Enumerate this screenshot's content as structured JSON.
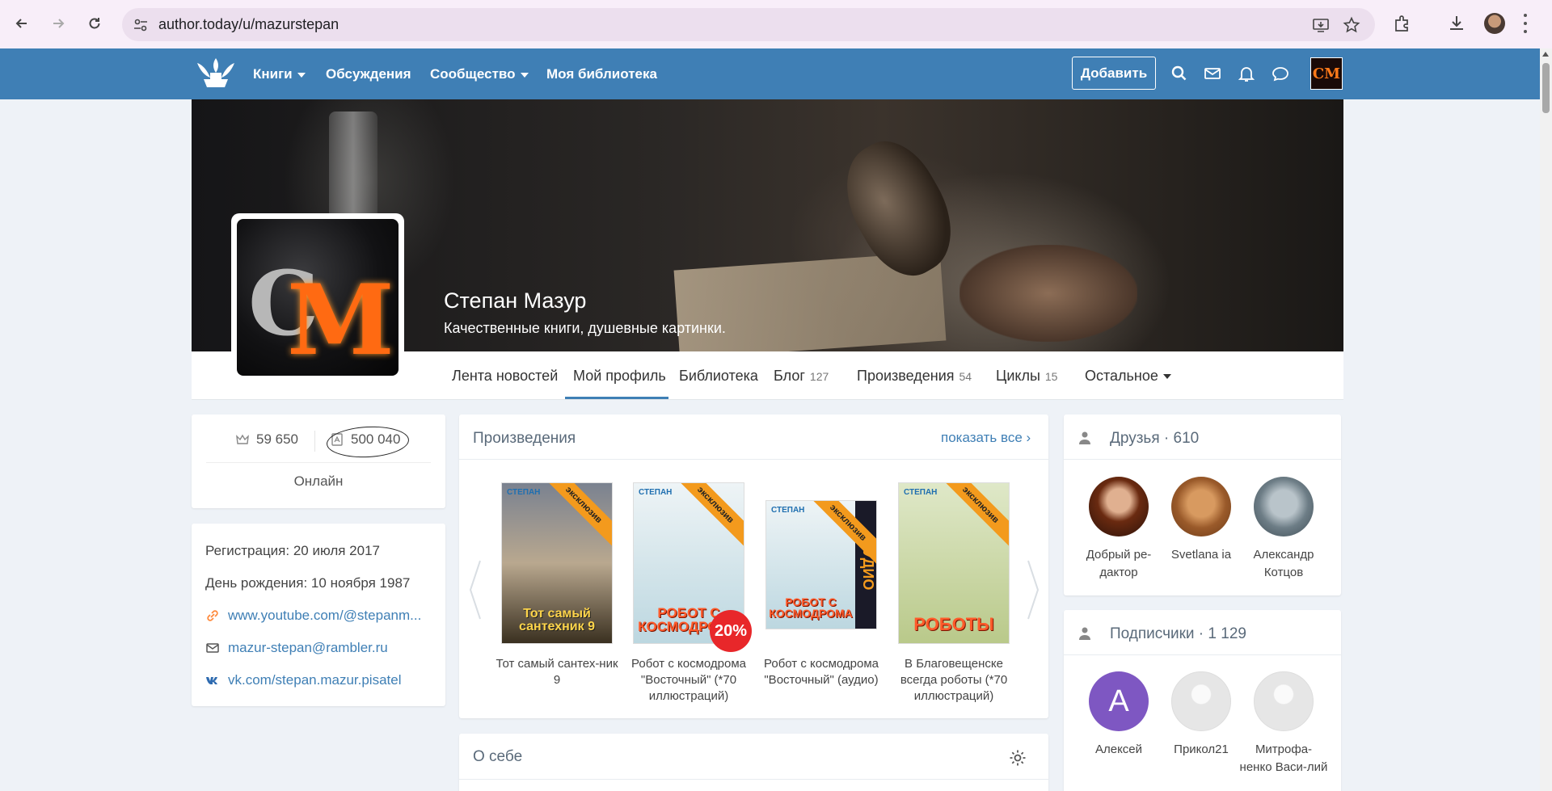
{
  "browser": {
    "url": "author.today/u/mazurstepan"
  },
  "header": {
    "nav": [
      {
        "label": "Книги",
        "dropdown": true
      },
      {
        "label": "Обсуждения",
        "dropdown": false
      },
      {
        "label": "Сообщество",
        "dropdown": true
      },
      {
        "label": "Моя библиотека",
        "dropdown": false
      }
    ],
    "add_label": "Добавить",
    "avatar_text": "CM"
  },
  "profile": {
    "name": "Степан Мазур",
    "status": "Качественные книги, душевные картинки."
  },
  "tabs": [
    {
      "label": "Лента новостей",
      "count": ""
    },
    {
      "label": "Мой профиль",
      "count": "",
      "active": true
    },
    {
      "label": "Библиотека",
      "count": ""
    },
    {
      "label": "Блог",
      "count": "127"
    },
    {
      "label": "Произведения",
      "count": "54"
    },
    {
      "label": "Циклы",
      "count": "15"
    },
    {
      "label": "Остальное",
      "count": "",
      "dropdown": true
    }
  ],
  "stats": {
    "rating": "59 650",
    "views": "500 040",
    "online": "Онлайн"
  },
  "info": {
    "registration": "Регистрация: 20 июля 2017",
    "birthday": "День рождения: 10 ноября 1987",
    "links": [
      {
        "icon": "link-icon",
        "text": "www.youtube.com/@stepanm..."
      },
      {
        "icon": "mail-icon",
        "text": "mazur-stepan@rambler.ru"
      },
      {
        "icon": "vk-icon",
        "text": "vk.com/stepan.mazur.pisatel"
      }
    ]
  },
  "works": {
    "title": "Произведения",
    "show_all": "показать все",
    "books": [
      {
        "caption": "Тот самый сантех-ник 9",
        "cover_title": "Тот самый сантехник 9",
        "ribbon": "эксклюзив",
        "colors": [
          "#7a8290",
          "#3a3020"
        ]
      },
      {
        "caption": "Робот с космодрома \"Восточный\" (*70 иллюстраций)",
        "cover_title": "РОБОТ С КОСМОДРОМА",
        "ribbon": "эксклюзив",
        "colors": [
          "#eef4f6",
          "#bcd7e0"
        ],
        "discount": "20%"
      },
      {
        "caption": "Робот с космодрома \"Восточный\" (аудио)",
        "cover_title": "РОБОТ С КОСМОДРОМА",
        "ribbon": "эксклюзив",
        "colors": [
          "#eef4f6",
          "#bcd7e0"
        ],
        "audio": "АУДИО"
      },
      {
        "caption": "В Благовещенске всегда роботы (*70 иллюстраций)",
        "cover_title": "РОБОТЫ",
        "ribbon": "эксклюзив",
        "colors": [
          "#dfe8c8",
          "#b9c98a"
        ]
      }
    ]
  },
  "about": {
    "title": "О себе"
  },
  "friends": {
    "title": "Друзья",
    "count": "610",
    "people": [
      {
        "name": "Добрый ре-дактор",
        "color": "#8a4a2a"
      },
      {
        "name": "Svetlana ia",
        "color": "#b07840"
      },
      {
        "name": "Александр Котцов",
        "color": "#7d8a90"
      }
    ]
  },
  "subscribers": {
    "title": "Подписчики",
    "count": "1 129",
    "people": [
      {
        "name": "Алексей",
        "letter": "А",
        "color": "#7e57c2"
      },
      {
        "name": "Прикол21",
        "letter": "",
        "color": "#e6e6e6"
      },
      {
        "name": "Митрофа-ненко Васи-лий",
        "letter": "",
        "color": "#e6e6e6"
      }
    ]
  },
  "colors": {
    "brand_blue": "#3f7fb5",
    "link_blue": "#3f7fb5",
    "ribbon_orange": "#f39a1d",
    "discount_red": "#e8272a"
  }
}
